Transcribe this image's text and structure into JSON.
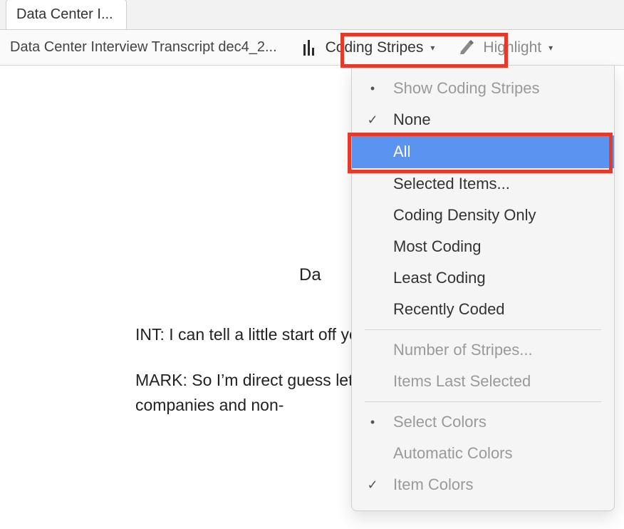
{
  "tab": {
    "title": "Data Center I..."
  },
  "toolbar": {
    "doc_title": "Data Center Interview Transcript dec4_2...",
    "coding_stripes_label": "Coding Stripes",
    "highlight_label": "Highlight"
  },
  "menu": {
    "items": [
      {
        "mark": "•",
        "label": "Show Coding Stripes",
        "state": "header-dim"
      },
      {
        "mark": "✓",
        "label": "None",
        "state": "normal"
      },
      {
        "mark": "",
        "label": "All",
        "state": "highlighted"
      },
      {
        "mark": "",
        "label": "Selected Items...",
        "state": "normal"
      },
      {
        "mark": "",
        "label": "Coding Density Only",
        "state": "normal"
      },
      {
        "mark": "",
        "label": "Most Coding",
        "state": "normal"
      },
      {
        "mark": "",
        "label": "Least Coding",
        "state": "normal"
      },
      {
        "mark": "",
        "label": "Recently Coded",
        "state": "normal"
      }
    ],
    "group2": [
      {
        "mark": "",
        "label": "Number of Stripes...",
        "state": "disabled"
      },
      {
        "mark": "",
        "label": "Items Last Selected",
        "state": "disabled"
      }
    ],
    "group3": [
      {
        "mark": "•",
        "label": "Select Colors",
        "state": "disabled"
      },
      {
        "mark": "",
        "label": "Automatic Colors",
        "state": "disabled"
      },
      {
        "mark": "✓",
        "label": "Item Colors",
        "state": "disabled"
      }
    ]
  },
  "document": {
    "heading_fragment": "Da",
    "p1": "INT:  I can tell a little start off you could jus operates and what in",
    "p2": "MARK:  So I’m direct guess let me start wi Internet services to c companies and non-"
  }
}
